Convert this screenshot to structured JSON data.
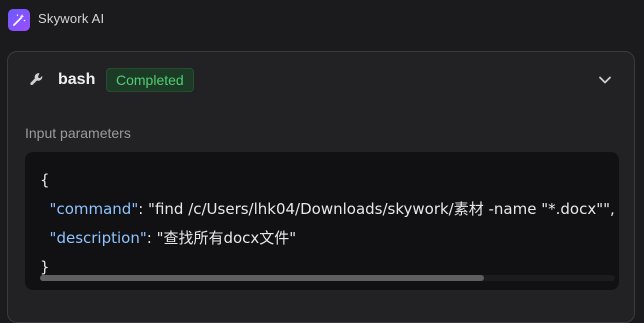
{
  "app": {
    "name": "Skywork AI",
    "logo_icon": "magic-wand-icon",
    "logo_color": "#7a55ff"
  },
  "tool_call": {
    "icon": "wrench-icon",
    "name": "bash",
    "status": "Completed",
    "status_color": "#4fcf72",
    "expand_icon": "chevron-down-icon"
  },
  "input": {
    "label": "Input parameters",
    "open_brace": "{",
    "close_brace": "}",
    "params": [
      {
        "key": "\"command\"",
        "sep": ": ",
        "value": "\"find /c/Users/lhk04/Downloads/skywork/素材 -name \"*.docx\"\"",
        "trail": ","
      },
      {
        "key": "\"description\"",
        "sep": ": ",
        "value": "\"查找所有docx文件\"",
        "trail": ""
      }
    ]
  }
}
